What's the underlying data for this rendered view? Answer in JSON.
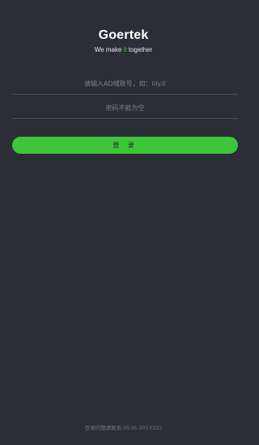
{
  "brand": {
    "logo_text": "Goertek",
    "tagline_prefix": "We make ",
    "tagline_accent": "it",
    "tagline_suffix": " together",
    "accent_color": "#45c83a"
  },
  "login_form": {
    "username_placeholder": "请输入AD域账号，如：lily.li",
    "username_value": "",
    "password_placeholder": "密码不能为空",
    "password_value": "",
    "submit_label": "登 录",
    "button_color": "#3ec63a"
  },
  "footer": {
    "contact_text": "登录问题请联系:0536-3053333"
  },
  "colors": {
    "background": "#2b2e34"
  }
}
